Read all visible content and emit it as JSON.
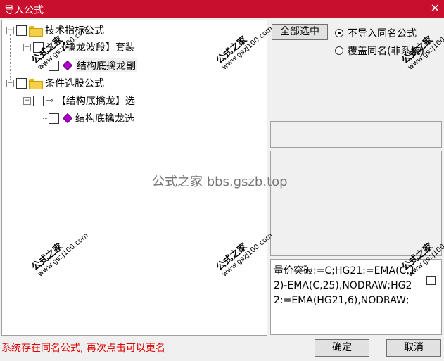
{
  "window": {
    "title": "导入公式",
    "close_glyph": "✕"
  },
  "tree": {
    "technical_folder": "技术指标公式",
    "set_item": "【擒龙波段】套装",
    "set_child": "结构底擒龙副",
    "condition_folder": "条件选股公式",
    "select_item": "【结构底擒龙】选",
    "select_child": "结构底擒龙选"
  },
  "options": {
    "select_all": "全部选中",
    "no_import_same": "不导入同名公式",
    "overwrite_same": "覆盖同名(非系统)",
    "selected": "no_import_same"
  },
  "formula": {
    "text": "量价突破:=C;HG21:=EMA(C,12)-EMA(C,25),NODRAW;HG22:=EMA(HG21,6),NODRAW;"
  },
  "watermarks": {
    "brand": "公式之家",
    "url": "www.gszj100.com",
    "center": "公式之家 bbs.gszb.top"
  },
  "footer": {
    "status": "系统存在同名公式, 再次点击可以更名",
    "ok": "确定",
    "cancel": "取消"
  },
  "icons": {
    "tree_item": "gem-icon",
    "folder": "folder-icon",
    "key": "key-icon"
  }
}
